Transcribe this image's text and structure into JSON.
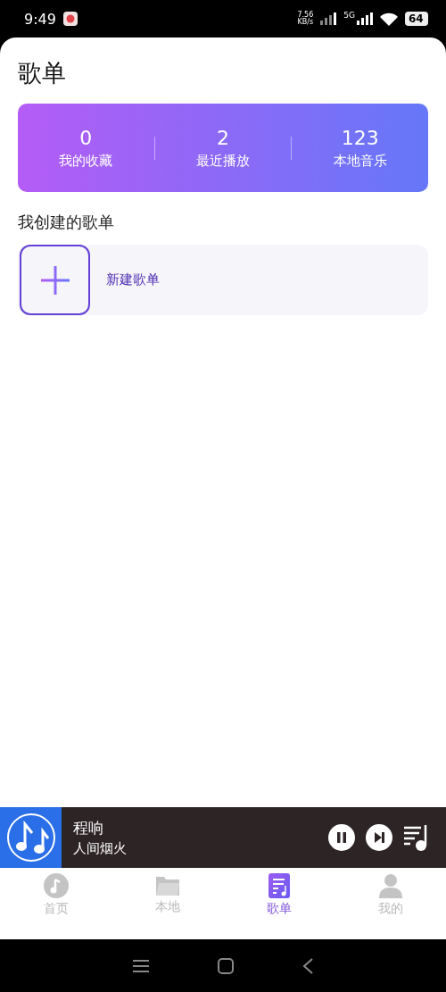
{
  "status_bar": {
    "time": "9:49",
    "speed_value": "7.56",
    "speed_unit": "KB/s",
    "network": "5G",
    "battery": "64"
  },
  "title": "歌单",
  "stats": [
    {
      "value": "0",
      "label": "我的收藏"
    },
    {
      "value": "2",
      "label": "最近播放"
    },
    {
      "value": "123",
      "label": "本地音乐"
    }
  ],
  "section_title": "我创建的歌单",
  "create_playlist": {
    "label": "新建歌单"
  },
  "player": {
    "artist": "程响",
    "song": "人间烟火",
    "playing": true
  },
  "tabs": [
    {
      "kind": "home",
      "label": "首页",
      "selected": false
    },
    {
      "kind": "local",
      "label": "本地",
      "selected": false
    },
    {
      "kind": "playlist",
      "label": "歌单",
      "selected": true
    },
    {
      "kind": "mine",
      "label": "我的",
      "selected": false
    }
  ]
}
